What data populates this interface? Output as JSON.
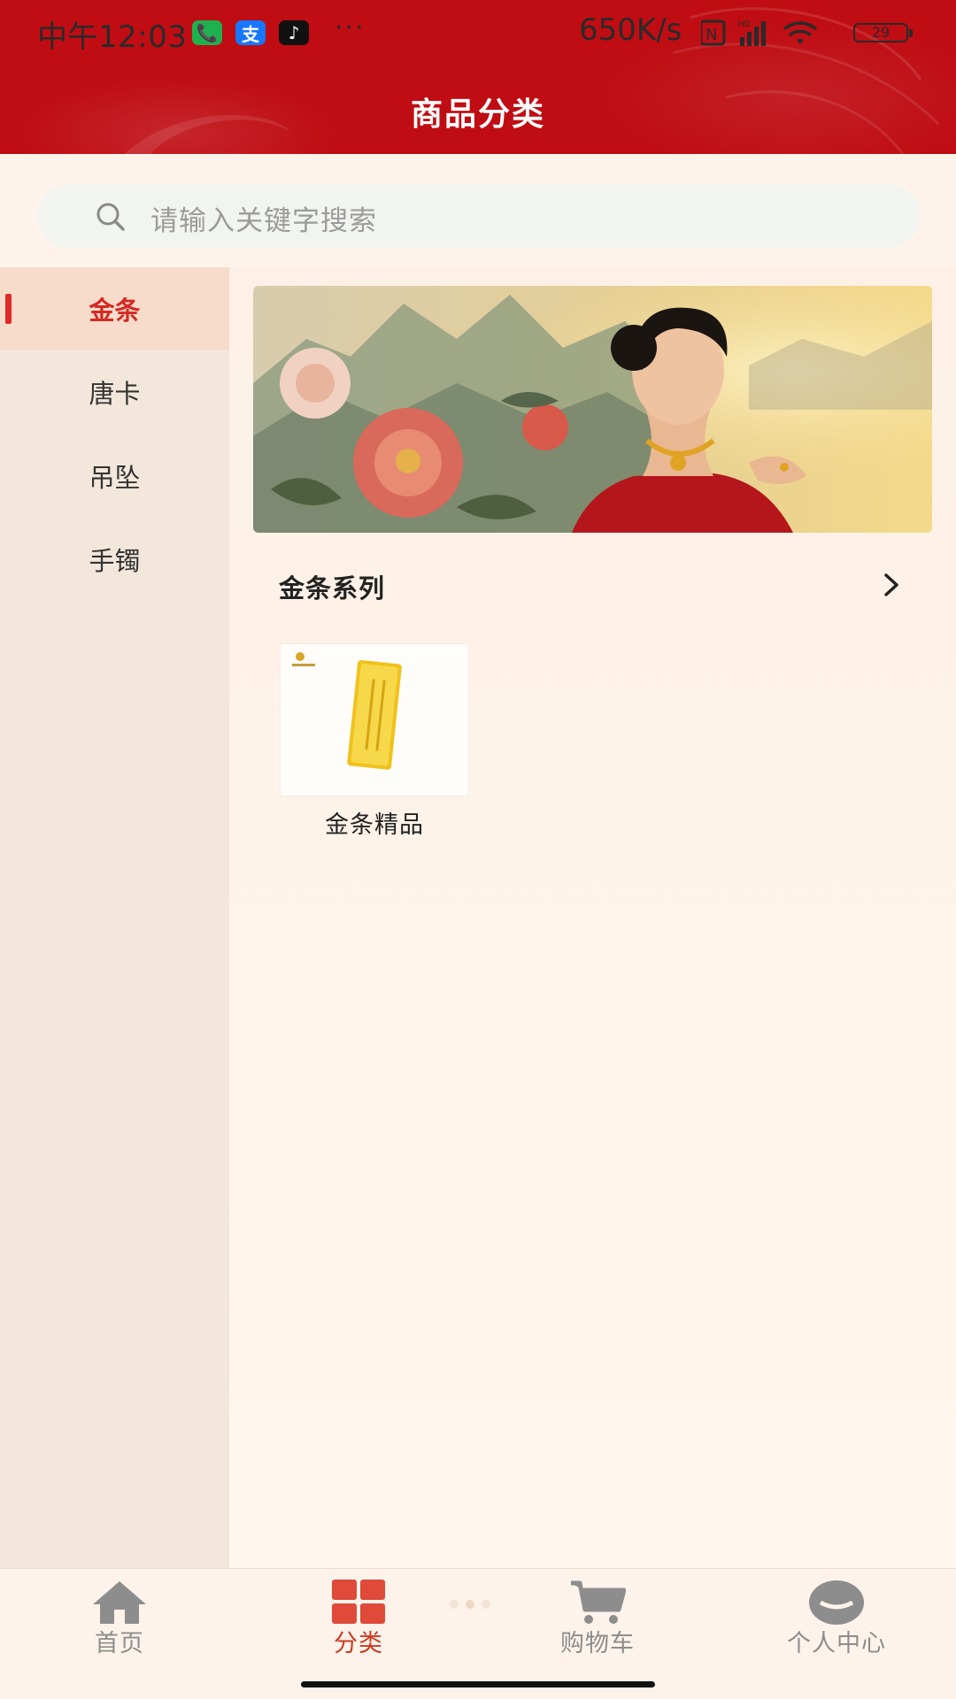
{
  "status_bar": {
    "time": "中午12:03",
    "app_icon_labels": [
      "📞",
      "支",
      "♪"
    ],
    "more": "···",
    "net_speed": "650K/s",
    "battery": "29"
  },
  "header": {
    "title": "商品分类"
  },
  "search": {
    "placeholder": "请输入关键字搜索",
    "icon": "search-icon"
  },
  "sidebar": {
    "items": [
      {
        "label": "金条",
        "active": true
      },
      {
        "label": "唐卡",
        "active": false
      },
      {
        "label": "吊坠",
        "active": false
      },
      {
        "label": "手镯",
        "active": false
      }
    ]
  },
  "main": {
    "banner_alt": "jewelry-banner",
    "section_title": "金条系列",
    "products": [
      {
        "name": "金条精品"
      }
    ]
  },
  "tabbar": {
    "items": [
      {
        "label": "首页",
        "icon": "home-icon",
        "active": false
      },
      {
        "label": "分类",
        "icon": "category-grid-icon",
        "active": true
      },
      {
        "label": "购物车",
        "icon": "cart-icon",
        "active": false
      },
      {
        "label": "个人中心",
        "icon": "profile-icon",
        "active": false
      }
    ]
  },
  "colors": {
    "brand_red": "#bf0d13",
    "active_red": "#d32a23",
    "background": "#fdf3ea"
  }
}
